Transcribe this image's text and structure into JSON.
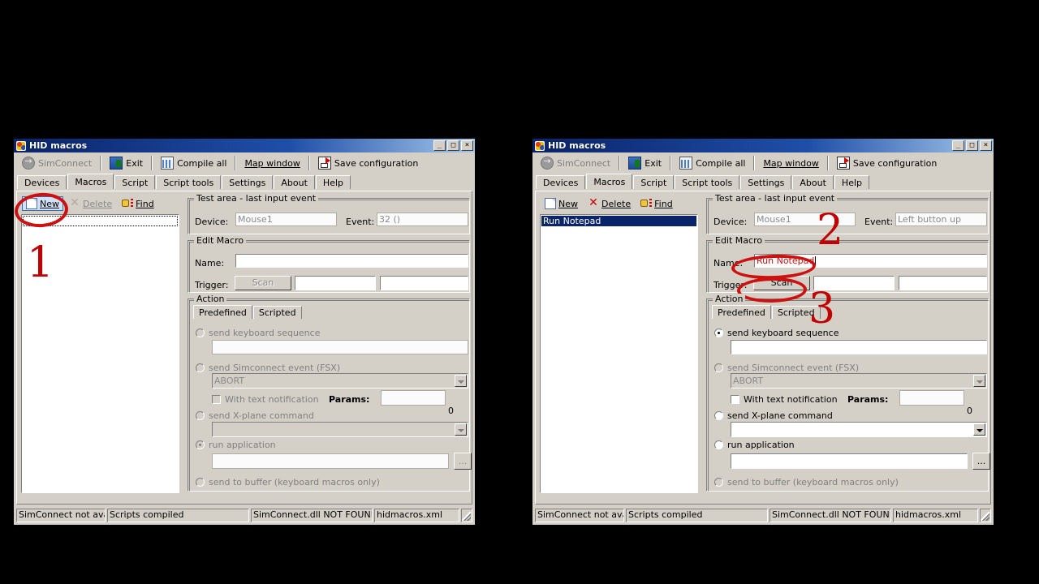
{
  "window": {
    "title": "HID macros",
    "icon": "app-icon",
    "buttons": {
      "minimize": "_",
      "maximize": "□",
      "close": "×"
    }
  },
  "toolbar": {
    "items": [
      {
        "label": "SimConnect",
        "icon": "simconnect-icon",
        "disabled": true,
        "accel": "i"
      },
      {
        "label": "Exit",
        "icon": "exit-icon",
        "disabled": false,
        "accel": "x"
      },
      {
        "label": "Compile all",
        "icon": "compile-icon",
        "disabled": false,
        "accel": ""
      },
      {
        "label": "Map window",
        "icon": "",
        "disabled": false,
        "accel": "M"
      },
      {
        "label": "Save configuration",
        "icon": "save-icon",
        "disabled": false,
        "accel": "a"
      }
    ]
  },
  "tabs": {
    "items": [
      "Devices",
      "Macros",
      "Script",
      "Script tools",
      "Settings",
      "About",
      "Help"
    ],
    "active": "Macros"
  },
  "list_toolbar": {
    "new": "New",
    "delete": "Delete",
    "find": "Find"
  },
  "test_area": {
    "title": "Test area - last input event",
    "device_label": "Device:",
    "event_label": "Event:",
    "device_value_left": "Mouse1",
    "event_value_left": "32 ()",
    "device_value_right": "Mouse1",
    "event_value_right": "Left button up"
  },
  "edit_macro": {
    "title": "Edit Macro",
    "name_label": "Name:",
    "trigger_label": "Trigger:",
    "scan_button": "Scan",
    "name_value_left": "",
    "name_value_right": "Run Notepad",
    "trigger_value_1": "",
    "trigger_value_2": ""
  },
  "action": {
    "title": "Action",
    "tabs": [
      "Predefined",
      "Scripted"
    ],
    "active_tab": "Predefined",
    "options": {
      "keyboard": "send keyboard sequence",
      "simconnect": "send Simconnect event (FSX)",
      "xplane": "send X-plane command",
      "run_app": "run application",
      "buffer": "send to buffer (keyboard macros only)"
    },
    "with_text_notification": "With text notification",
    "params_label": "Params:",
    "params_value": "",
    "params_counter": "0",
    "simconnect_combo_value": "ABORT",
    "xplane_combo_value": "",
    "keyboard_value": "",
    "run_app_value": "",
    "browse_button": "...",
    "selected_left": "run_app",
    "selected_right": "keyboard"
  },
  "macro_list": {
    "left_items": [],
    "right_items": [
      "Run Notepad"
    ],
    "selected_right": "Run Notepad"
  },
  "statusbar": {
    "cells": [
      "SimConnect not avai",
      "Scripts compiled",
      "SimConnect.dll NOT FOUND",
      "hidmacros.xml"
    ]
  },
  "annotations": {
    "step1": "1",
    "step2": "2",
    "step3": "3",
    "color": "#cc1111"
  }
}
